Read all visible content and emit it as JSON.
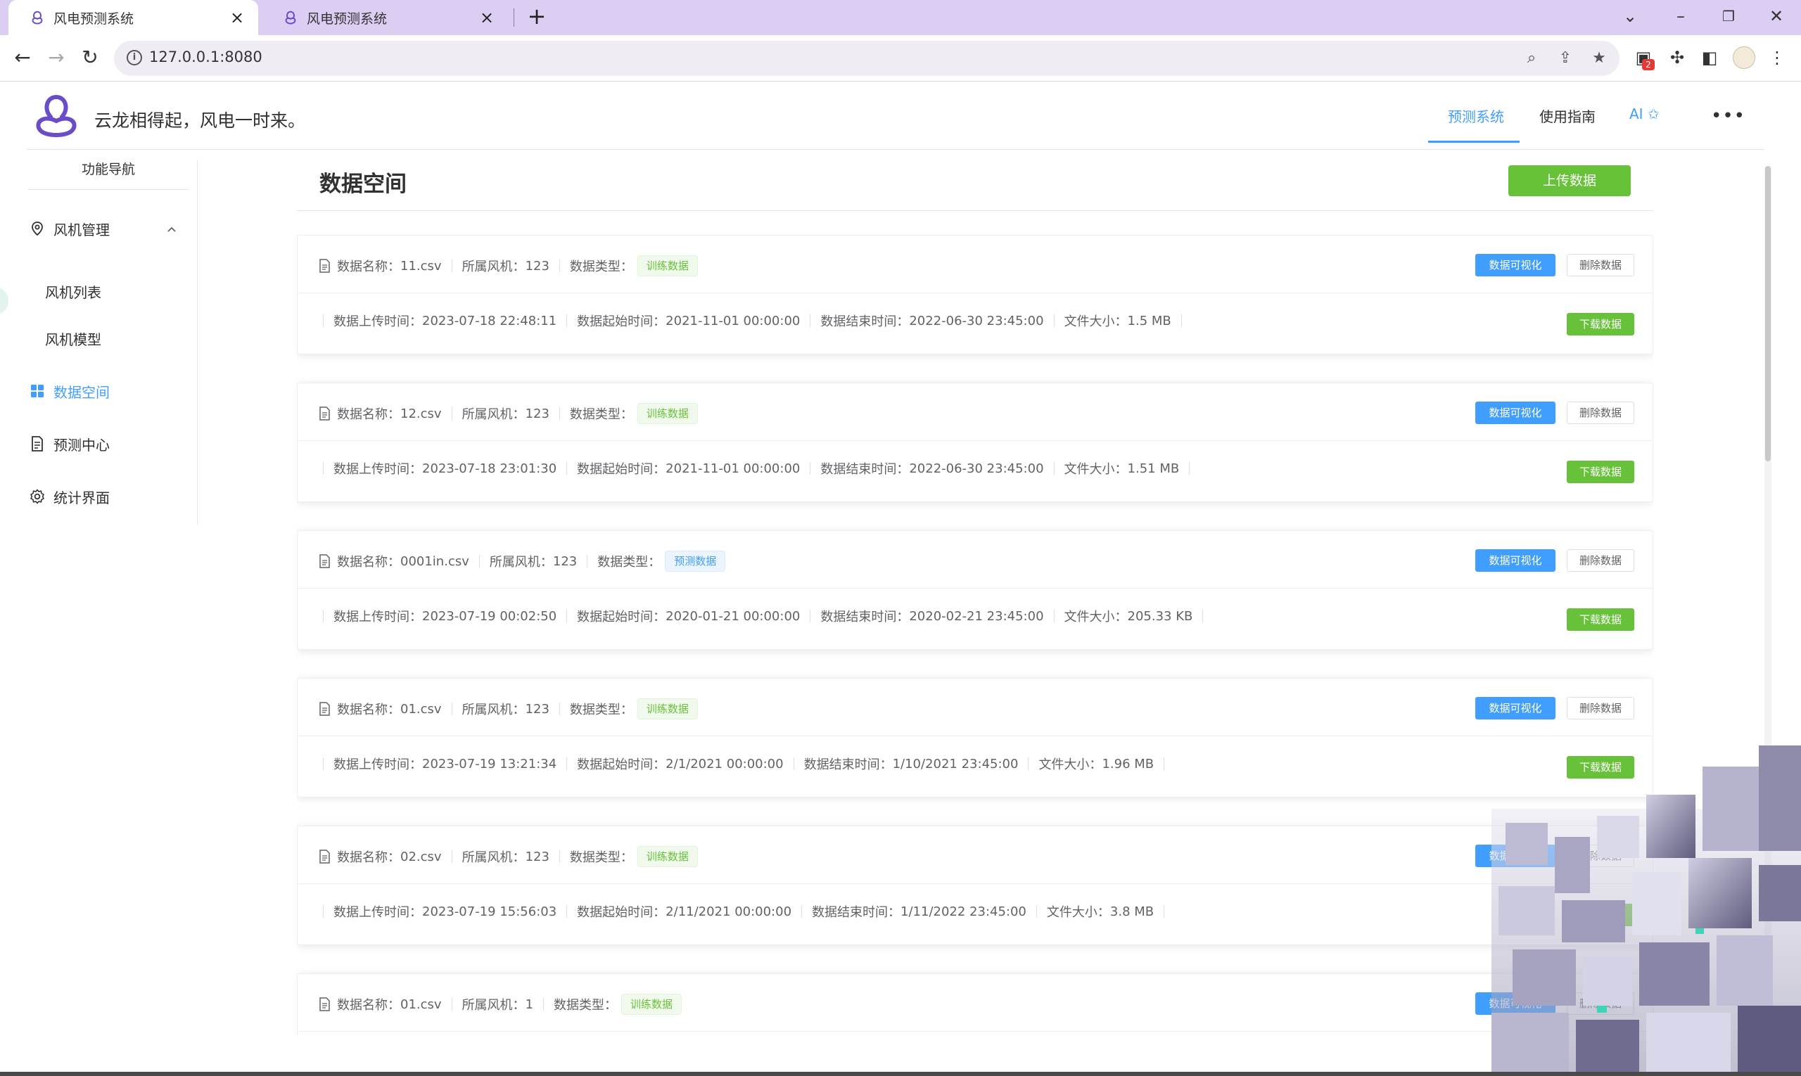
{
  "browser": {
    "tabs": [
      {
        "title": "风电预测系统",
        "active": true
      },
      {
        "title": "风电预测系统",
        "active": false
      }
    ],
    "url": "127.0.0.1:8080",
    "extension_badge": "2"
  },
  "header": {
    "slogan": "云龙相得起，风电一时来。",
    "nav": [
      "预测系统",
      "使用指南",
      "AI ✩"
    ],
    "more": "•••"
  },
  "sidebar": {
    "title": "功能导航",
    "items": [
      {
        "label": "风机管理",
        "icon": "location-pin-icon"
      },
      {
        "label": "风机列表"
      },
      {
        "label": "风机模型"
      },
      {
        "label": "数据空间",
        "icon": "grid-icon",
        "active": true
      },
      {
        "label": "预测中心",
        "icon": "document-icon"
      },
      {
        "label": "统计界面",
        "icon": "gear-icon"
      }
    ]
  },
  "main": {
    "title": "数据空间",
    "upload_label": "上传数据",
    "labels": {
      "name": "数据名称：",
      "turbine": "所属风机：",
      "type": "数据类型：",
      "upload_time": "数据上传时间：",
      "start_time": "数据起始时间：",
      "end_time": "数据结束时间：",
      "size": "文件大小："
    },
    "buttons": {
      "viz": "数据可视化",
      "del": "删除数据",
      "dl": "下载数据"
    },
    "records": [
      {
        "name": "11.csv",
        "turbine": "123",
        "type": "训练数据",
        "kind": "train",
        "upload": "2023-07-18 22:48:11",
        "start": "2021-11-01 00:00:00",
        "end": "2022-06-30 23:45:00",
        "size": "1.5 MB"
      },
      {
        "name": "12.csv",
        "turbine": "123",
        "type": "训练数据",
        "kind": "train",
        "upload": "2023-07-18 23:01:30",
        "start": "2021-11-01 00:00:00",
        "end": "2022-06-30 23:45:00",
        "size": "1.51 MB"
      },
      {
        "name": "0001in.csv",
        "turbine": "123",
        "type": "预测数据",
        "kind": "predict",
        "upload": "2023-07-19 00:02:50",
        "start": "2020-01-21 00:00:00",
        "end": "2020-02-21 23:45:00",
        "size": "205.33 KB"
      },
      {
        "name": "01.csv",
        "turbine": "123",
        "type": "训练数据",
        "kind": "train",
        "upload": "2023-07-19 13:21:34",
        "start": "2/1/2021 00:00:00",
        "end": "1/10/2021 23:45:00",
        "size": "1.96 MB"
      },
      {
        "name": "02.csv",
        "turbine": "123",
        "type": "训练数据",
        "kind": "train",
        "upload": "2023-07-19 15:56:03",
        "start": "2/11/2021 00:00:00",
        "end": "1/11/2022 23:45:00",
        "size": "3.8 MB"
      },
      {
        "name": "01.csv",
        "turbine": "1",
        "type": "训练数据",
        "kind": "train"
      }
    ]
  },
  "colors": {
    "primary": "#409eff",
    "success": "#67c23a",
    "tabstrip": "#dccdf3"
  }
}
